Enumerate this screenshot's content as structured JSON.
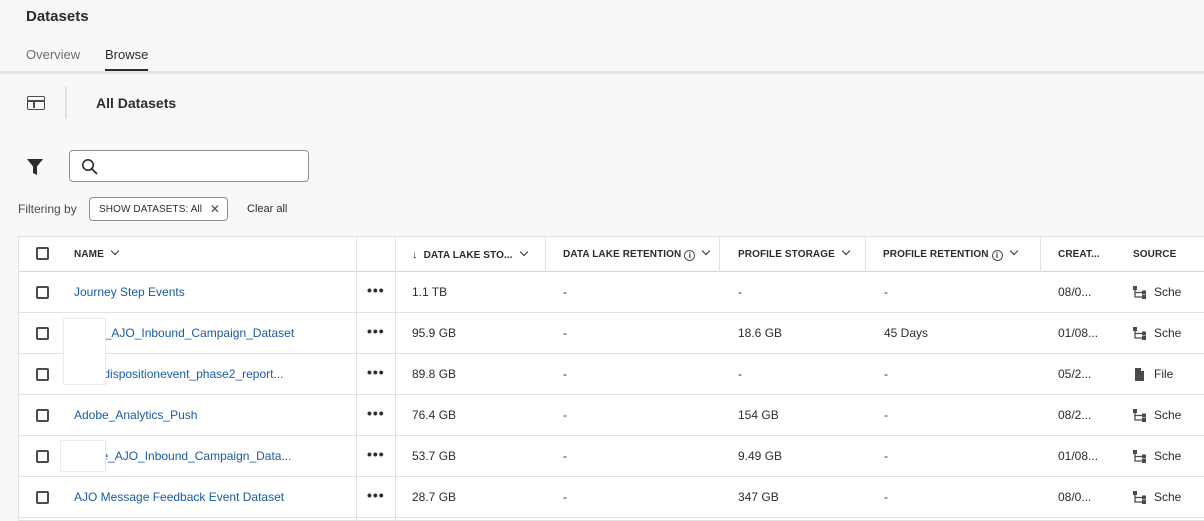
{
  "page": {
    "title": "Datasets"
  },
  "tabs": [
    {
      "label": "Overview",
      "active": false
    },
    {
      "label": "Browse",
      "active": true
    }
  ],
  "section": {
    "title": "All Datasets"
  },
  "search": {
    "value": "",
    "placeholder": ""
  },
  "filters": {
    "label": "Filtering by",
    "tag": "SHOW DATASETS: All",
    "clear_label": "Clear all"
  },
  "table": {
    "columns": {
      "name": "NAME",
      "data_lake_storage": "DATA LAKE STO...",
      "data_lake_retention": "DATA LAKE RETENTION",
      "profile_storage": "PROFILE STORAGE",
      "profile_retention": "PROFILE RETENTION",
      "created": "CREAT...",
      "source": "SOURCE"
    },
    "sorted_by": "data_lake_storage",
    "rows": [
      {
        "name": "Journey Step Events",
        "dl_storage": "1.1 TB",
        "dl_retention": "-",
        "profile_storage": "-",
        "profile_retention": "-",
        "created": "08/0...",
        "source": "Sche",
        "source_icon": "schema-icon"
      },
      {
        "name": "Event_AJO_Inbound_Campaign_Dataset",
        "dl_storage": "95.9 GB",
        "dl_retention": "-",
        "profile_storage": "18.6 GB",
        "profile_retention": "45 Days",
        "created": "01/08...",
        "source": "Sche",
        "source_icon": "schema-icon"
      },
      {
        "name": "d_ajodispositionevent_phase2_report...",
        "dl_storage": "89.8 GB",
        "dl_retention": "-",
        "profile_storage": "-",
        "profile_retention": "-",
        "created": "05/2...",
        "source": "File",
        "source_icon": "file-icon"
      },
      {
        "name": "Adobe_Analytics_Push",
        "dl_storage": "76.4 GB",
        "dl_retention": "-",
        "profile_storage": "154 GB",
        "profile_retention": "-",
        "created": "08/2...",
        "source": "Sche",
        "source_icon": "schema-icon"
      },
      {
        "name": "Profile_AJO_Inbound_Campaign_Data...",
        "dl_storage": "53.7 GB",
        "dl_retention": "-",
        "profile_storage": "9.49 GB",
        "profile_retention": "-",
        "created": "01/08...",
        "source": "Sche",
        "source_icon": "schema-icon"
      },
      {
        "name": "AJO Message Feedback Event Dataset",
        "dl_storage": "28.7 GB",
        "dl_retention": "-",
        "profile_storage": "347 GB",
        "profile_retention": "-",
        "created": "08/0...",
        "source": "Sche",
        "source_icon": "schema-icon"
      }
    ]
  },
  "icons": {
    "sidebar_toggle": "sidebar-toggle-icon",
    "filter": "filter-icon",
    "search": "search-icon",
    "info": "info-icon",
    "more": "more-actions-icon"
  },
  "colors": {
    "link": "#1a5aa6",
    "text": "#2c2c2c",
    "background": "#f8f8f8"
  }
}
